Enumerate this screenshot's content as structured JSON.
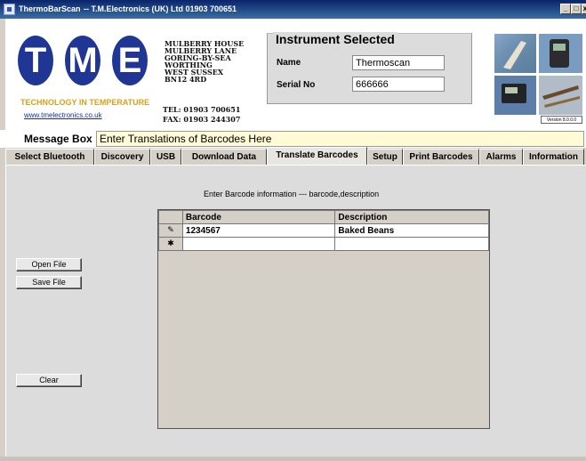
{
  "window": {
    "app_name": "ThermoBarScan",
    "company_line": "-- T.M.Electronics (UK) Ltd  01903 700651",
    "min_glyph": "_",
    "max_glyph": "□",
    "close_glyph": "x"
  },
  "logo": {
    "letters": [
      "T",
      "M",
      "E"
    ],
    "tagline": "TECHNOLOGY IN TEMPERATURE",
    "website": "www.tmelectronics.co.uk",
    "brand_color": "#1f3694",
    "tagline_color": "#d7a21b"
  },
  "address": {
    "lines": [
      "MULBERRY HOUSE",
      "MULBERRY LANE",
      "GORING-BY-SEA",
      "WORTHING",
      "WEST SUSSEX",
      "BN12 4RD"
    ],
    "tel": "TEL:  01903 700651",
    "fax": "FAX:  01903 244307"
  },
  "instrument": {
    "title": "Instrument Selected",
    "name_label": "Name",
    "name_value": "Thermoscan",
    "serial_label": "Serial No",
    "serial_value": "666666"
  },
  "version": "Version 8.0.0.0",
  "message_box": {
    "label": "Message Box",
    "text": "Enter Translations of Barcodes Here"
  },
  "tabs": [
    {
      "label": "Select Bluetooth"
    },
    {
      "label": "Discovery"
    },
    {
      "label": "USB"
    },
    {
      "label": "Download Data"
    },
    {
      "label": "Translate Barcodes",
      "active": true
    },
    {
      "label": "Setup"
    },
    {
      "label": "Print Barcodes"
    },
    {
      "label": "Alarms"
    },
    {
      "label": "Information"
    }
  ],
  "translate": {
    "hint": "Enter Barcode information  ---  barcode,description",
    "buttons": {
      "open": "Open File",
      "save": "Save File",
      "clear": "Clear"
    },
    "columns": [
      "Barcode",
      "Description"
    ],
    "rows": [
      {
        "indicator": "✎",
        "barcode": "1234567",
        "description": "Baked Beans"
      },
      {
        "indicator": "✱",
        "barcode": "",
        "description": ""
      }
    ]
  }
}
